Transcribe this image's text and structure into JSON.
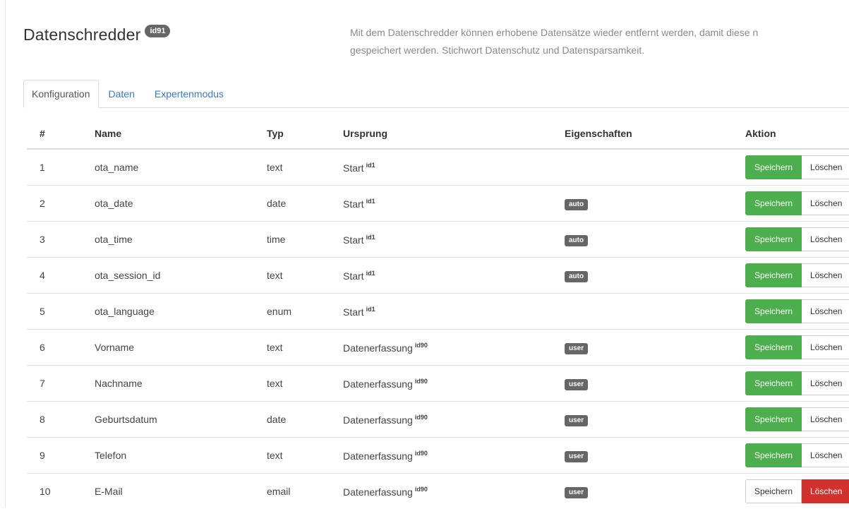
{
  "header": {
    "title": "Datenschredder",
    "badge": "id91",
    "description_line1": "Mit dem Datenschredder können erhobene Datensätze wieder entfernt werden, damit diese n",
    "description_line2": "gespeichert werden. Stichwort Datenschutz und Datensparsamkeit."
  },
  "tabs": [
    {
      "label": "Konfiguration",
      "active": true
    },
    {
      "label": "Daten",
      "active": false
    },
    {
      "label": "Expertenmodus",
      "active": false
    }
  ],
  "table": {
    "headers": {
      "num": "#",
      "name": "Name",
      "typ": "Typ",
      "ursprung": "Ursprung",
      "eigenschaften": "Eigenschaften",
      "aktion": "Aktion"
    },
    "rows": [
      {
        "num": "1",
        "name": "ota_name",
        "typ": "text",
        "ursprung": "Start",
        "ursprung_id": "id1",
        "tag": "",
        "save": "Speichern",
        "delete": "Löschen",
        "delete_active": false
      },
      {
        "num": "2",
        "name": "ota_date",
        "typ": "date",
        "ursprung": "Start",
        "ursprung_id": "id1",
        "tag": "auto",
        "save": "Speichern",
        "delete": "Löschen",
        "delete_active": false
      },
      {
        "num": "3",
        "name": "ota_time",
        "typ": "time",
        "ursprung": "Start",
        "ursprung_id": "id1",
        "tag": "auto",
        "save": "Speichern",
        "delete": "Löschen",
        "delete_active": false
      },
      {
        "num": "4",
        "name": "ota_session_id",
        "typ": "text",
        "ursprung": "Start",
        "ursprung_id": "id1",
        "tag": "auto",
        "save": "Speichern",
        "delete": "Löschen",
        "delete_active": false
      },
      {
        "num": "5",
        "name": "ota_language",
        "typ": "enum",
        "ursprung": "Start",
        "ursprung_id": "id1",
        "tag": "",
        "save": "Speichern",
        "delete": "Löschen",
        "delete_active": false
      },
      {
        "num": "6",
        "name": "Vorname",
        "typ": "text",
        "ursprung": "Datenerfassung",
        "ursprung_id": "id90",
        "tag": "user",
        "save": "Speichern",
        "delete": "Löschen",
        "delete_active": false
      },
      {
        "num": "7",
        "name": "Nachname",
        "typ": "text",
        "ursprung": "Datenerfassung",
        "ursprung_id": "id90",
        "tag": "user",
        "save": "Speichern",
        "delete": "Löschen",
        "delete_active": false
      },
      {
        "num": "8",
        "name": "Geburtsdatum",
        "typ": "date",
        "ursprung": "Datenerfassung",
        "ursprung_id": "id90",
        "tag": "user",
        "save": "Speichern",
        "delete": "Löschen",
        "delete_active": false
      },
      {
        "num": "9",
        "name": "Telefon",
        "typ": "text",
        "ursprung": "Datenerfassung",
        "ursprung_id": "id90",
        "tag": "user",
        "save": "Speichern",
        "delete": "Löschen",
        "delete_active": false
      },
      {
        "num": "10",
        "name": "E-Mail",
        "typ": "email",
        "ursprung": "Datenerfassung",
        "ursprung_id": "id90",
        "tag": "user",
        "save": "Speichern",
        "delete": "Löschen",
        "delete_active": true
      }
    ]
  },
  "colors": {
    "save_green": "#4cae4c",
    "delete_red": "#d2322d",
    "tag_gray": "#666666",
    "link_blue": "#3a7bbf"
  }
}
